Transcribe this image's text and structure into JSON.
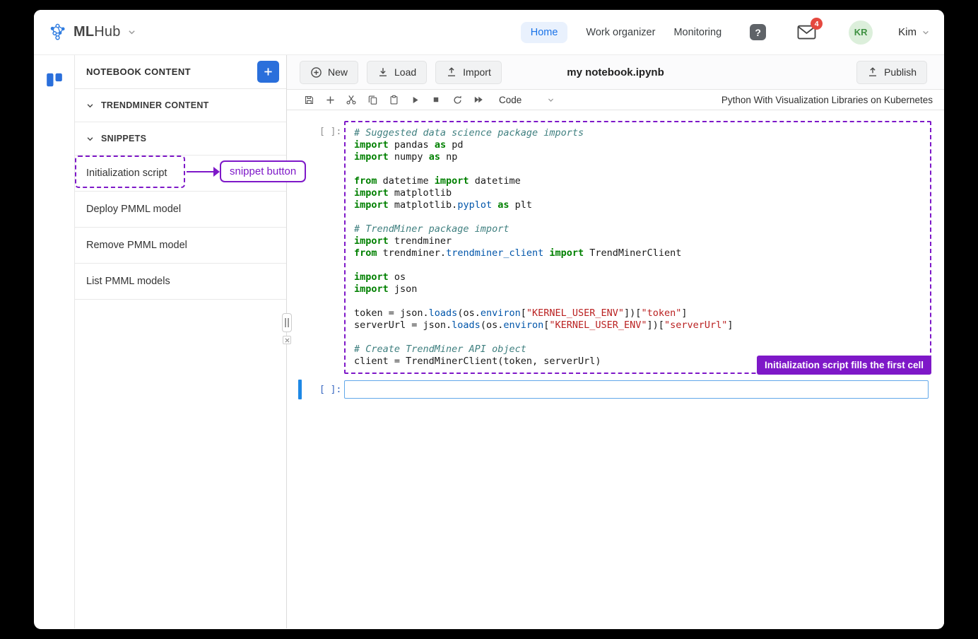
{
  "colors": {
    "annotation_purple": "#7e18c8",
    "accent_blue": "#2a6fdb",
    "home_blue": "#1a73e8",
    "cell_bar_blue": "#1e88e5",
    "cell_border_blue": "#62a8ea",
    "badge_red": "#e5483f",
    "avatar_bg": "#dcefdb",
    "avatar_text": "#3f9142",
    "code_comment": "#408080",
    "code_keyword": "#008000",
    "code_string": "#ba2121",
    "code_property": "#0055aa",
    "prompt_gray": "#8f8f8f",
    "prompt_blue": "#3465c0"
  },
  "header": {
    "logo_bold": "ML",
    "logo_light": "Hub",
    "nav": [
      {
        "label": "Home"
      },
      {
        "label": "Work organizer"
      },
      {
        "label": "Monitoring"
      }
    ],
    "help_glyph": "?",
    "mail_badge_count": "4",
    "avatar_initials": "KR",
    "user_name": "Kim"
  },
  "sidebar": {
    "title": "NOTEBOOK CONTENT",
    "sections": [
      {
        "label": "TRENDMINER CONTENT"
      },
      {
        "label": "SNIPPETS"
      }
    ],
    "snippet_items": [
      {
        "label": "Initialization script"
      },
      {
        "label": "Deploy PMML model"
      },
      {
        "label": "Remove PMML model"
      },
      {
        "label": "List PMML models"
      }
    ]
  },
  "annotations": {
    "snippet_button_label": "snippet button",
    "first_cell_label": "Initialization script fills the first cell"
  },
  "notebook": {
    "new_label": "New",
    "load_label": "Load",
    "import_label": "Import",
    "publish_label": "Publish",
    "file_title": "my notebook.ipynb",
    "cell_type_selected": "Code",
    "kernel_name": "Python With Visualization Libraries on Kubernetes",
    "toolbar_icon_names": [
      "save",
      "add-cell",
      "cut",
      "copy",
      "paste",
      "run",
      "stop",
      "restart",
      "run-all"
    ],
    "cell1_prompt": "[ ]:",
    "cell2_prompt": "[ ]:",
    "cell2_value": "",
    "code_lines": [
      [
        {
          "t": "c",
          "s": "# Suggested data science package imports"
        }
      ],
      [
        {
          "t": "k",
          "s": "import"
        },
        {
          "t": "p",
          "s": " pandas "
        },
        {
          "t": "k",
          "s": "as"
        },
        {
          "t": "p",
          "s": " pd"
        }
      ],
      [
        {
          "t": "k",
          "s": "import"
        },
        {
          "t": "p",
          "s": " numpy "
        },
        {
          "t": "k",
          "s": "as"
        },
        {
          "t": "p",
          "s": " np"
        }
      ],
      [],
      [
        {
          "t": "k",
          "s": "from"
        },
        {
          "t": "p",
          "s": " datetime "
        },
        {
          "t": "k",
          "s": "import"
        },
        {
          "t": "p",
          "s": " datetime"
        }
      ],
      [
        {
          "t": "k",
          "s": "import"
        },
        {
          "t": "p",
          "s": " matplotlib"
        }
      ],
      [
        {
          "t": "k",
          "s": "import"
        },
        {
          "t": "p",
          "s": " matplotlib."
        },
        {
          "t": "pr",
          "s": "pyplot"
        },
        {
          "t": "p",
          "s": " "
        },
        {
          "t": "k",
          "s": "as"
        },
        {
          "t": "p",
          "s": " plt"
        }
      ],
      [],
      [
        {
          "t": "c",
          "s": "# TrendMiner package import"
        }
      ],
      [
        {
          "t": "k",
          "s": "import"
        },
        {
          "t": "p",
          "s": " trendminer"
        }
      ],
      [
        {
          "t": "k",
          "s": "from"
        },
        {
          "t": "p",
          "s": " trendminer."
        },
        {
          "t": "pr",
          "s": "trendminer_client"
        },
        {
          "t": "p",
          "s": " "
        },
        {
          "t": "k",
          "s": "import"
        },
        {
          "t": "p",
          "s": " TrendMinerClient"
        }
      ],
      [],
      [
        {
          "t": "k",
          "s": "import"
        },
        {
          "t": "p",
          "s": " os"
        }
      ],
      [
        {
          "t": "k",
          "s": "import"
        },
        {
          "t": "p",
          "s": " json"
        }
      ],
      [],
      [
        {
          "t": "p",
          "s": "token = json."
        },
        {
          "t": "pr",
          "s": "loads"
        },
        {
          "t": "p",
          "s": "(os."
        },
        {
          "t": "pr",
          "s": "environ"
        },
        {
          "t": "p",
          "s": "["
        },
        {
          "t": "s",
          "s": "\"KERNEL_USER_ENV\""
        },
        {
          "t": "p",
          "s": "])["
        },
        {
          "t": "s",
          "s": "\"token\""
        },
        {
          "t": "p",
          "s": "]"
        }
      ],
      [
        {
          "t": "p",
          "s": "serverUrl = json."
        },
        {
          "t": "pr",
          "s": "loads"
        },
        {
          "t": "p",
          "s": "(os."
        },
        {
          "t": "pr",
          "s": "environ"
        },
        {
          "t": "p",
          "s": "["
        },
        {
          "t": "s",
          "s": "\"KERNEL_USER_ENV\""
        },
        {
          "t": "p",
          "s": "])["
        },
        {
          "t": "s",
          "s": "\"serverUrl\""
        },
        {
          "t": "p",
          "s": "]"
        }
      ],
      [],
      [
        {
          "t": "c",
          "s": "# Create TrendMiner API object"
        }
      ],
      [
        {
          "t": "p",
          "s": "client = TrendMinerClient(token, serverUrl)"
        }
      ]
    ]
  }
}
